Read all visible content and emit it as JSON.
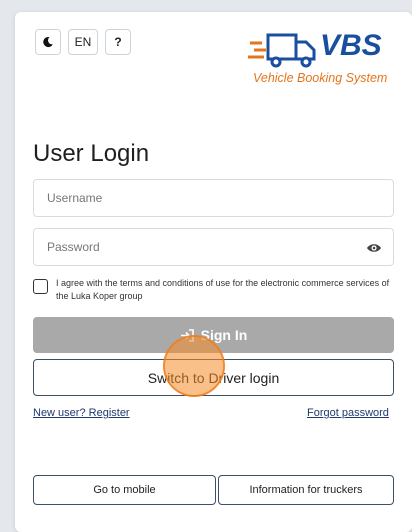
{
  "topbar": {
    "theme_icon": "moon-icon",
    "language": "EN",
    "help": "?"
  },
  "logo": {
    "icon": "truck-icon",
    "name": "VBS",
    "subtitle": "Vehicle Booking System",
    "colors": {
      "primary": "#1a4fa0",
      "accent": "#e4751c"
    }
  },
  "login": {
    "title": "User Login",
    "username_placeholder": "Username",
    "password_placeholder": "Password",
    "eye_icon": "eye-icon",
    "agree_text": "I agree with the terms and conditions of use for the electronic commerce services of the Luka Koper group",
    "sign_in_icon": "sign-in-icon",
    "sign_in_label": "Sign In",
    "driver_login_label": "Switch to Driver login",
    "register_link": "New user? Register",
    "forgot_link": "Forgot password",
    "mobile_button": "Go to mobile",
    "truckers_button": "Information for truckers"
  }
}
